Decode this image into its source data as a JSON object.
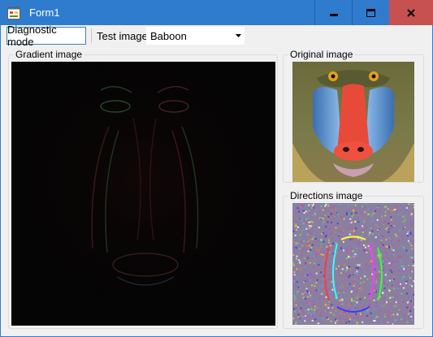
{
  "window": {
    "title": "Form1",
    "minimize_label": "minimize",
    "maximize_label": "maximize",
    "close_label": "close"
  },
  "toolbar": {
    "diagnostic_button": "Diagnostic mode",
    "test_image_label": "Test image",
    "test_image_value": "Baboon"
  },
  "panels": {
    "gradient_title": "Gradient image",
    "original_title": "Original image",
    "directions_title": "Directions image"
  },
  "icons": {
    "app": "form-app-icon",
    "minimize": "minimize-icon",
    "maximize": "maximize-icon",
    "close": "close-icon",
    "dropdown": "chevron-down-icon"
  },
  "colors": {
    "titlebar": "#2f7ccf",
    "close_button": "#c75050",
    "client_background": "#f0f0f0",
    "gradient_background": "#050505"
  }
}
